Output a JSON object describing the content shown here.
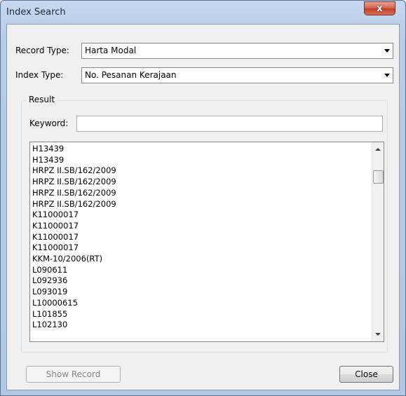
{
  "window": {
    "title": "Index Search",
    "close_glyph": "x"
  },
  "form": {
    "record_type_label": "Record Type:",
    "record_type_value": "Harta Modal",
    "index_type_label": "Index Type:",
    "index_type_value": "No. Pesanan Kerajaan",
    "result_group_label": "Result",
    "keyword_label": "Keyword:",
    "keyword_value": ""
  },
  "results": [
    "H13439",
    "H13439",
    "HRPZ II.SB/162/2009",
    "HRPZ II.SB/162/2009",
    "HRPZ II.SB/162/2009",
    "HRPZ II.SB/162/2009",
    "K11000017",
    "K11000017",
    "K11000017",
    "K11000017",
    "KKM-10/2006(RT)",
    "L090611",
    "L092936",
    "L093019",
    "L10000615",
    "L101855",
    "L102130"
  ],
  "buttons": {
    "show_record": "Show Record",
    "close": "Close"
  }
}
